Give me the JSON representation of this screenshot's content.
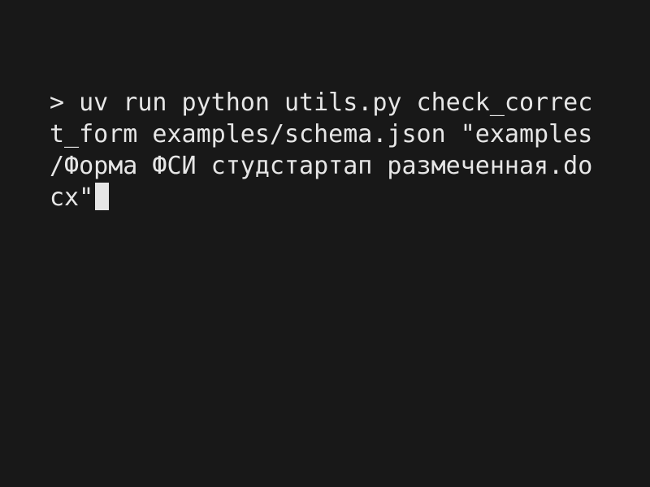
{
  "terminal": {
    "prompt": ">",
    "lines": [
      " uv run python utils.py check_correc",
      "t_form examples/schema.json \"examples",
      "/Форма ФСИ студстартап размеченная.do",
      "cx\""
    ],
    "colors": {
      "background": "#181818",
      "text": "#e6e6e6",
      "cursor": "#e6e6e6"
    }
  }
}
